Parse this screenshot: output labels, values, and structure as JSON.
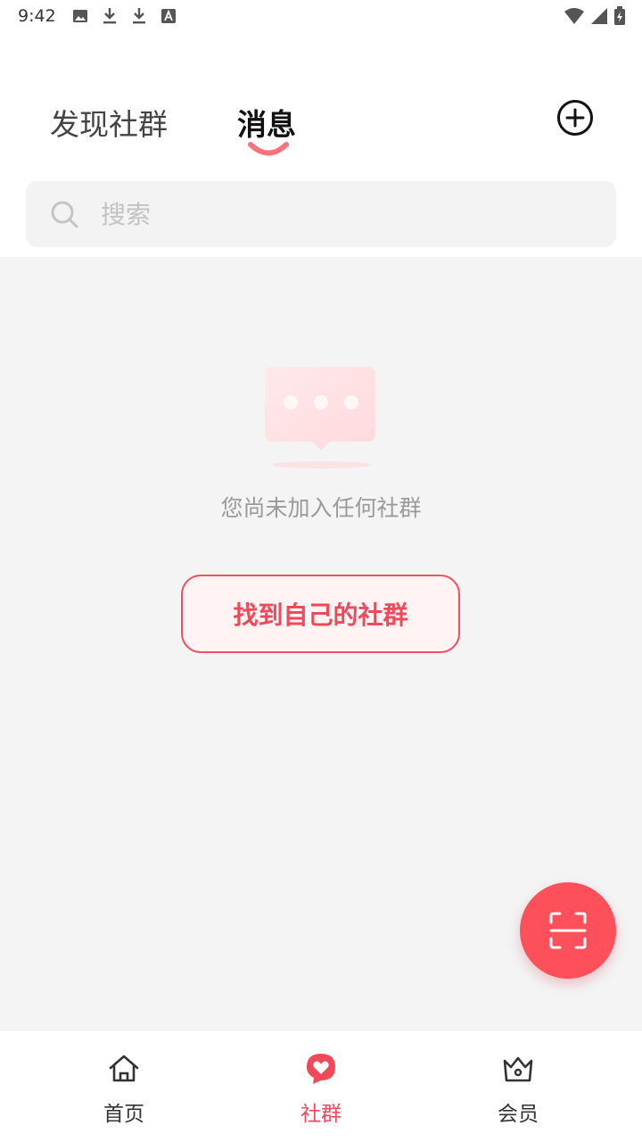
{
  "status_bar": {
    "time": "9:42"
  },
  "tabs": {
    "discover_label": "发现社群",
    "messages_label": "消息"
  },
  "search": {
    "placeholder": "搜索",
    "value": ""
  },
  "empty_state": {
    "message": "您尚未加入任何社群",
    "button_label": "找到自己的社群"
  },
  "bottom_nav": {
    "items": [
      {
        "label": "首页",
        "icon": "home-icon"
      },
      {
        "label": "社群",
        "icon": "heart-chat-icon"
      },
      {
        "label": "会员",
        "icon": "crown-icon"
      }
    ]
  },
  "colors": {
    "accent": "#f04a5a",
    "fab": "#fd505b",
    "content_bg": "#f4f4f5"
  }
}
